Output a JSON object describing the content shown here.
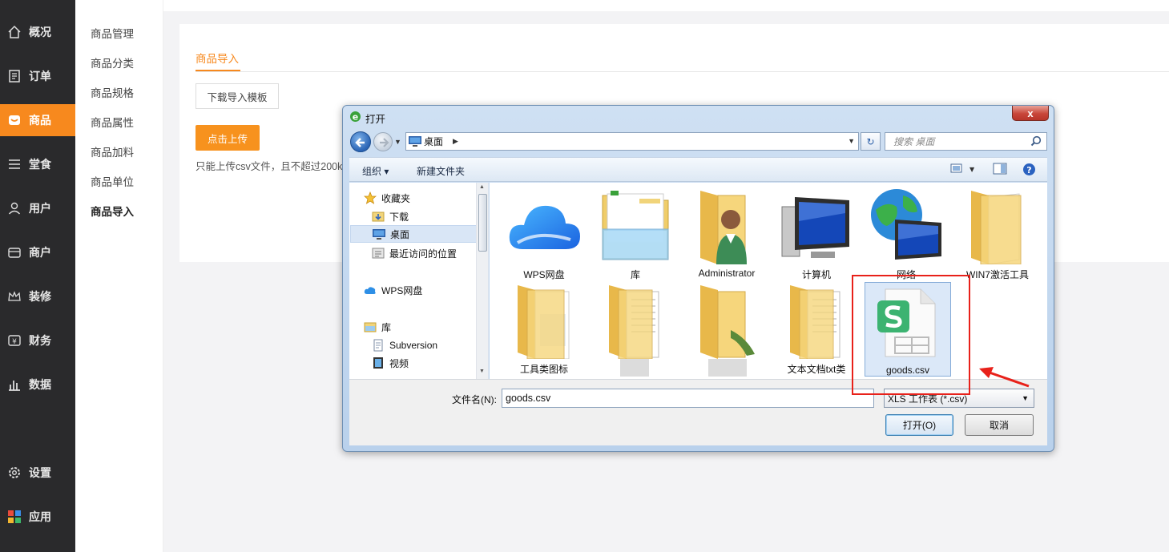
{
  "sidebar": {
    "items": [
      {
        "label": "概况",
        "icon": "home-icon"
      },
      {
        "label": "订单",
        "icon": "order-icon"
      },
      {
        "label": "商品",
        "icon": "goods-icon",
        "active": true
      },
      {
        "label": "堂食",
        "icon": "menu-icon"
      },
      {
        "label": "用户",
        "icon": "user-icon"
      },
      {
        "label": "商户",
        "icon": "merchant-icon"
      },
      {
        "label": "装修",
        "icon": "crown-icon"
      },
      {
        "label": "财务",
        "icon": "finance-icon"
      },
      {
        "label": "数据",
        "icon": "chart-icon"
      }
    ],
    "bottom_items": [
      {
        "label": "设置",
        "icon": "gear-icon"
      },
      {
        "label": "应用",
        "icon": "apps-icon"
      }
    ],
    "accent_color": "#f7891e"
  },
  "subnav": {
    "items": [
      {
        "label": "商品管理"
      },
      {
        "label": "商品分类"
      },
      {
        "label": "商品规格"
      },
      {
        "label": "商品属性"
      },
      {
        "label": "商品加料"
      },
      {
        "label": "商品单位"
      },
      {
        "label": "商品导入",
        "active": true
      }
    ]
  },
  "main": {
    "tab_label": "商品导入",
    "download_button": "下载导入模板",
    "upload_button": "点击上传",
    "hint": "只能上传csv文件，且不超过200kb"
  },
  "dialog": {
    "title": "打开",
    "close_label": "x",
    "address": "桌面",
    "search_placeholder": "搜索 桌面",
    "toolbar": {
      "organize": "组织 ▾",
      "new_folder": "新建文件夹"
    },
    "nav_tree": [
      {
        "label": "收藏夹",
        "icon": "star-icon"
      },
      {
        "label": "下载",
        "icon": "download-folder-icon"
      },
      {
        "label": "桌面",
        "icon": "desktop-icon",
        "selected": true
      },
      {
        "label": "最近访问的位置",
        "icon": "recent-icon"
      },
      {
        "label": "WPS网盘",
        "icon": "cloud-icon"
      },
      {
        "label": "库",
        "icon": "library-icon"
      },
      {
        "label": "Subversion",
        "icon": "document-icon"
      },
      {
        "label": "视频",
        "icon": "video-icon"
      }
    ],
    "files": [
      {
        "name": "WPS网盘",
        "icon": "cloud-icon"
      },
      {
        "name": "库",
        "icon": "library-folder-icon"
      },
      {
        "name": "Administrator",
        "icon": "user-folder-icon"
      },
      {
        "name": "计算机",
        "icon": "computer-icon"
      },
      {
        "name": "网络",
        "icon": "network-icon"
      },
      {
        "name": "WIN7激活工具",
        "icon": "folder-icon"
      },
      {
        "name": "工具类图标",
        "icon": "folder-icon"
      },
      {
        "name": "",
        "icon": "folder-icon"
      },
      {
        "name": "",
        "icon": "folder-icon"
      },
      {
        "name": "文本文档txt类",
        "icon": "folder-icon"
      },
      {
        "name": "goods.csv",
        "icon": "wps-spreadsheet-icon",
        "selected": true
      }
    ],
    "filename_label": "文件名(N):",
    "filename_value": "goods.csv",
    "filter_value": "XLS 工作表 (*.csv)",
    "open_button": "打开(O)",
    "cancel_button": "取消"
  }
}
